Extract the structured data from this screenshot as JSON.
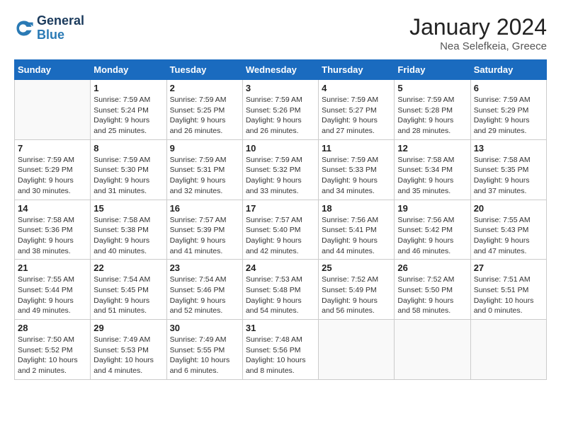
{
  "logo": {
    "line1": "General",
    "line2": "Blue"
  },
  "title": "January 2024",
  "location": "Nea Selefkeia, Greece",
  "weekdays": [
    "Sunday",
    "Monday",
    "Tuesday",
    "Wednesday",
    "Thursday",
    "Friday",
    "Saturday"
  ],
  "weeks": [
    [
      {
        "day": null
      },
      {
        "day": 1,
        "sunrise": "7:59 AM",
        "sunset": "5:24 PM",
        "daylight": "9 hours and 25 minutes."
      },
      {
        "day": 2,
        "sunrise": "7:59 AM",
        "sunset": "5:25 PM",
        "daylight": "9 hours and 26 minutes."
      },
      {
        "day": 3,
        "sunrise": "7:59 AM",
        "sunset": "5:26 PM",
        "daylight": "9 hours and 26 minutes."
      },
      {
        "day": 4,
        "sunrise": "7:59 AM",
        "sunset": "5:27 PM",
        "daylight": "9 hours and 27 minutes."
      },
      {
        "day": 5,
        "sunrise": "7:59 AM",
        "sunset": "5:28 PM",
        "daylight": "9 hours and 28 minutes."
      },
      {
        "day": 6,
        "sunrise": "7:59 AM",
        "sunset": "5:29 PM",
        "daylight": "9 hours and 29 minutes."
      }
    ],
    [
      {
        "day": 7,
        "sunrise": "7:59 AM",
        "sunset": "5:29 PM",
        "daylight": "9 hours and 30 minutes."
      },
      {
        "day": 8,
        "sunrise": "7:59 AM",
        "sunset": "5:30 PM",
        "daylight": "9 hours and 31 minutes."
      },
      {
        "day": 9,
        "sunrise": "7:59 AM",
        "sunset": "5:31 PM",
        "daylight": "9 hours and 32 minutes."
      },
      {
        "day": 10,
        "sunrise": "7:59 AM",
        "sunset": "5:32 PM",
        "daylight": "9 hours and 33 minutes."
      },
      {
        "day": 11,
        "sunrise": "7:59 AM",
        "sunset": "5:33 PM",
        "daylight": "9 hours and 34 minutes."
      },
      {
        "day": 12,
        "sunrise": "7:58 AM",
        "sunset": "5:34 PM",
        "daylight": "9 hours and 35 minutes."
      },
      {
        "day": 13,
        "sunrise": "7:58 AM",
        "sunset": "5:35 PM",
        "daylight": "9 hours and 37 minutes."
      }
    ],
    [
      {
        "day": 14,
        "sunrise": "7:58 AM",
        "sunset": "5:36 PM",
        "daylight": "9 hours and 38 minutes."
      },
      {
        "day": 15,
        "sunrise": "7:58 AM",
        "sunset": "5:38 PM",
        "daylight": "9 hours and 40 minutes."
      },
      {
        "day": 16,
        "sunrise": "7:57 AM",
        "sunset": "5:39 PM",
        "daylight": "9 hours and 41 minutes."
      },
      {
        "day": 17,
        "sunrise": "7:57 AM",
        "sunset": "5:40 PM",
        "daylight": "9 hours and 42 minutes."
      },
      {
        "day": 18,
        "sunrise": "7:56 AM",
        "sunset": "5:41 PM",
        "daylight": "9 hours and 44 minutes."
      },
      {
        "day": 19,
        "sunrise": "7:56 AM",
        "sunset": "5:42 PM",
        "daylight": "9 hours and 46 minutes."
      },
      {
        "day": 20,
        "sunrise": "7:55 AM",
        "sunset": "5:43 PM",
        "daylight": "9 hours and 47 minutes."
      }
    ],
    [
      {
        "day": 21,
        "sunrise": "7:55 AM",
        "sunset": "5:44 PM",
        "daylight": "9 hours and 49 minutes."
      },
      {
        "day": 22,
        "sunrise": "7:54 AM",
        "sunset": "5:45 PM",
        "daylight": "9 hours and 51 minutes."
      },
      {
        "day": 23,
        "sunrise": "7:54 AM",
        "sunset": "5:46 PM",
        "daylight": "9 hours and 52 minutes."
      },
      {
        "day": 24,
        "sunrise": "7:53 AM",
        "sunset": "5:48 PM",
        "daylight": "9 hours and 54 minutes."
      },
      {
        "day": 25,
        "sunrise": "7:52 AM",
        "sunset": "5:49 PM",
        "daylight": "9 hours and 56 minutes."
      },
      {
        "day": 26,
        "sunrise": "7:52 AM",
        "sunset": "5:50 PM",
        "daylight": "9 hours and 58 minutes."
      },
      {
        "day": 27,
        "sunrise": "7:51 AM",
        "sunset": "5:51 PM",
        "daylight": "10 hours and 0 minutes."
      }
    ],
    [
      {
        "day": 28,
        "sunrise": "7:50 AM",
        "sunset": "5:52 PM",
        "daylight": "10 hours and 2 minutes."
      },
      {
        "day": 29,
        "sunrise": "7:49 AM",
        "sunset": "5:53 PM",
        "daylight": "10 hours and 4 minutes."
      },
      {
        "day": 30,
        "sunrise": "7:49 AM",
        "sunset": "5:55 PM",
        "daylight": "10 hours and 6 minutes."
      },
      {
        "day": 31,
        "sunrise": "7:48 AM",
        "sunset": "5:56 PM",
        "daylight": "10 hours and 8 minutes."
      },
      {
        "day": null
      },
      {
        "day": null
      },
      {
        "day": null
      }
    ]
  ],
  "labels": {
    "sunrise": "Sunrise:",
    "sunset": "Sunset:",
    "daylight": "Daylight:"
  }
}
